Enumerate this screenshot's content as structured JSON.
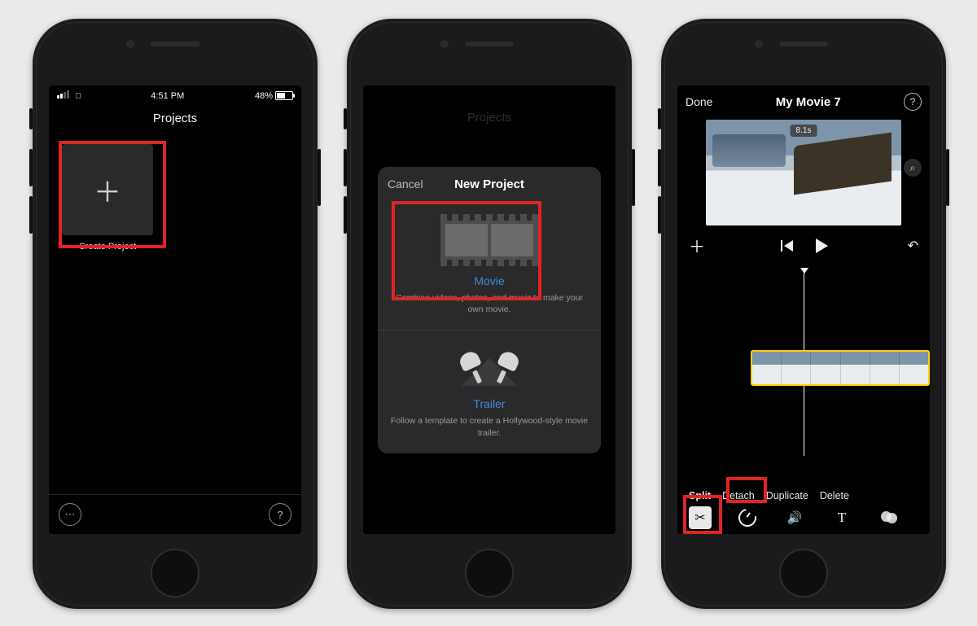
{
  "phone1": {
    "status": {
      "time": "4:51 PM",
      "battery_pct": "48%"
    },
    "title": "Projects",
    "create_label": "Create Project",
    "plus": "＋",
    "more": "⋯",
    "help": "?"
  },
  "phone2": {
    "bg_title": "Projects",
    "sheet": {
      "cancel": "Cancel",
      "title": "New Project",
      "movie": {
        "label": "Movie",
        "desc": "Combine videos, photos, and music to make your own movie."
      },
      "trailer": {
        "label": "Trailer",
        "desc": "Follow a template to create a Hollywood-style movie trailer."
      }
    }
  },
  "phone3": {
    "done": "Done",
    "title": "My Movie 7",
    "help": "?",
    "duration_badge": "8.1s",
    "zoom_glyph": "⌕",
    "add": "＋",
    "undo": "↶",
    "tabs": {
      "split": "Split",
      "detach": "Detach",
      "duplicate": "Duplicate",
      "delete": "Delete"
    },
    "tools": {
      "scissors": "✂",
      "volume": "🔊",
      "text": "T"
    }
  }
}
